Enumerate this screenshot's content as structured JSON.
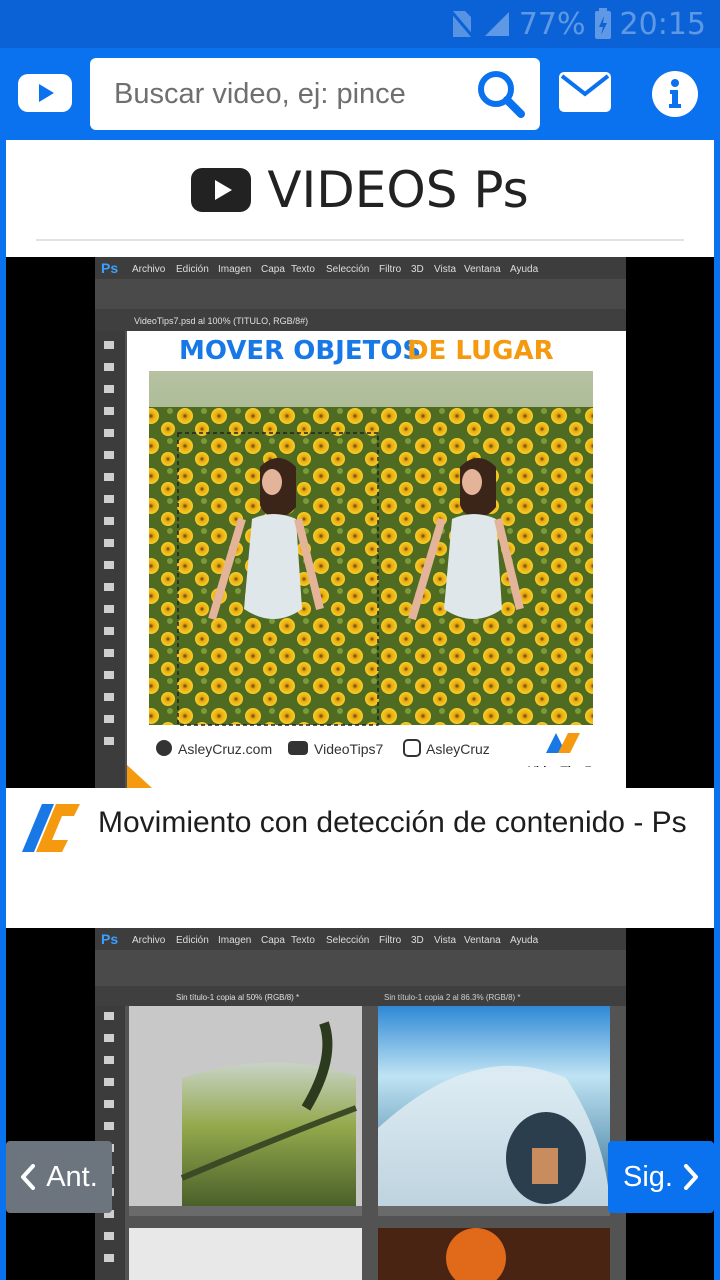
{
  "status_bar": {
    "battery": "77%",
    "time": "20:15"
  },
  "header": {
    "search_placeholder": "Buscar video, ej: pince",
    "icons": [
      "youtube-icon",
      "search-icon",
      "mail-icon",
      "info-icon"
    ]
  },
  "page": {
    "title": "VIDEOS Ps",
    "title_icon": "youtube-icon"
  },
  "videos": [
    {
      "thumb_menu": [
        "Archivo",
        "Edición",
        "Imagen",
        "Capa",
        "Texto",
        "Selección",
        "Filtro",
        "3D",
        "Vista",
        "Ventana",
        "Ayuda"
      ],
      "thumb_headline_a": "MOVER OBJETOS",
      "thumb_headline_b": "DE LUGAR",
      "thumb_tab": "VideoTips7.psd al 100% (TITULO, RGB/8#)",
      "thumb_footer": [
        "AsleyCruz.com",
        "VideoTips7",
        "AsleyCruz"
      ],
      "thumb_brand": "VideoTips7",
      "caption": "Movimiento con detección de contenido - Ps"
    },
    {
      "thumb_menu": [
        "Archivo",
        "Edición",
        "Imagen",
        "Capa",
        "Texto",
        "Selección",
        "Filtro",
        "3D",
        "Vista",
        "Ventana",
        "Ayuda"
      ],
      "thumb_tab_left": "Sin título-1 copia al 50% (RGB/8) *",
      "thumb_tab_right": "Sin título-1 copia 2 al 86.3% (RGB/8) *"
    }
  ],
  "pagination": {
    "prev_label": "Ant.",
    "next_label": "Sig."
  },
  "colors": {
    "primary": "#0a72ee",
    "status_bar": "#0a62d6",
    "secondary_button": "#6c757d",
    "brand_orange": "#f59a0e",
    "brand_blue": "#1778e6"
  }
}
